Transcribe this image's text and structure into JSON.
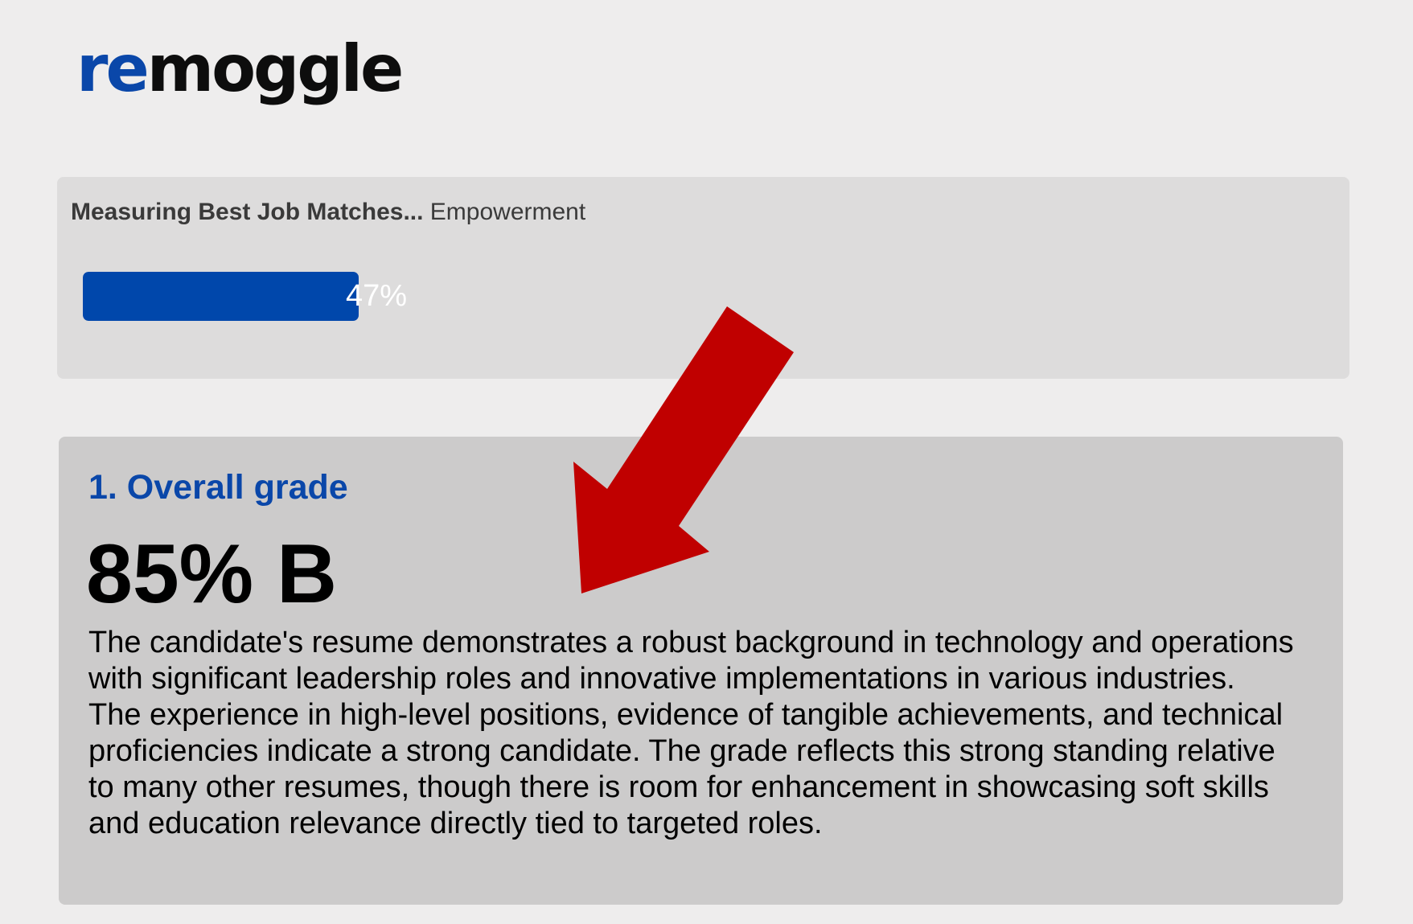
{
  "logo": {
    "accent": "re",
    "rest": "moggle"
  },
  "progress": {
    "heading_bold": "Measuring Best Job Matches...",
    "heading_item": "Empowerment",
    "value": 0.47,
    "label": "47%"
  },
  "grade": {
    "section_title": "1. Overall grade",
    "value": "85% B",
    "description": "The candidate's resume demonstrates a robust background in technology and operations with significant leadership roles and innovative implementations in various industries. The experience in high-level positions, evidence of tangible achievements, and technical proficiencies indicate a strong candidate. The grade reflects this strong standing relative to many other resumes, though there is room for enhancement in showcasing soft skills and education relevance directly tied to targeted roles."
  },
  "colors": {
    "brand_blue": "#0047ab",
    "arrow_red": "#c00000",
    "page_background": "#eeeded",
    "panel_light": "#dddcdc",
    "panel_dark": "#cccbcb"
  }
}
